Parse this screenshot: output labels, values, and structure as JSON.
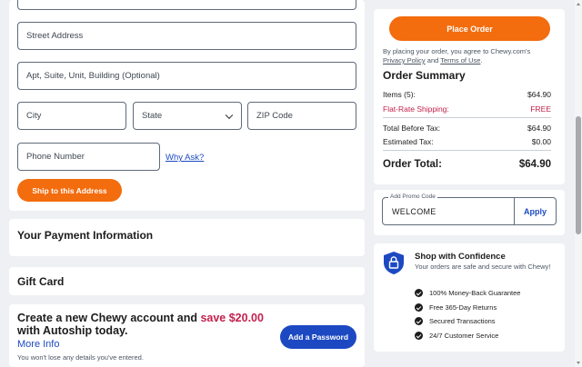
{
  "address": {
    "street_placeholder": "Street Address",
    "apt_placeholder": "Apt, Suite, Unit, Building (Optional)",
    "city_placeholder": "City",
    "state_placeholder": "State",
    "zip_placeholder": "ZIP Code",
    "phone_placeholder": "Phone Number",
    "why_ask": "Why Ask?",
    "ship_button": "Ship to this Address"
  },
  "payment": {
    "title": "Your Payment Information"
  },
  "gift": {
    "title": "Gift Card"
  },
  "account": {
    "headline_1": "Create a new Chewy account and ",
    "headline_save": "save $20.00",
    "headline_2": " with Autoship today.",
    "more_info": "More Info",
    "note": "You won't lose any details you've entered.",
    "button": "Add a Password"
  },
  "order": {
    "place_button": "Place Order",
    "terms_1": "By placing your order, you agree to Chewy.com's",
    "privacy": "Privacy Policy",
    "and": " and ",
    "terms_of_use": "Terms of Use",
    "period": ".",
    "summary_title": "Order Summary",
    "items_label": "Items (5):",
    "items_value": "$64.90",
    "shipping_label": "Flat-Rate Shipping:",
    "shipping_value": "FREE",
    "before_tax_label": "Total Before Tax:",
    "before_tax_value": "$64.90",
    "tax_label": "Estimated Tax:",
    "tax_value": "$0.00",
    "total_label": "Order Total:",
    "total_value": "$64.90",
    "accent_color": "#c4214d"
  },
  "promo": {
    "label": "Add Promo Code",
    "value": "WELCOME",
    "apply": "Apply"
  },
  "confidence": {
    "title": "Shop with Confidence",
    "subtitle": "Your orders are safe and secure with Chewy!",
    "items": [
      "100% Money-Back Guarantee",
      "Free 365-Day Returns",
      "Secured Transactions",
      "24/7 Customer Service"
    ]
  },
  "colors": {
    "brand_orange": "#f36c0e",
    "brand_blue": "#1c49c2"
  }
}
